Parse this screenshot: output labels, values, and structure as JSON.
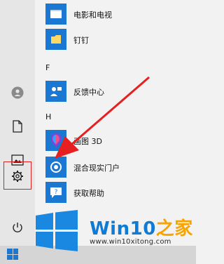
{
  "apps": [
    {
      "name": "电影和电视",
      "icon": "film-icon"
    },
    {
      "name": "钉钉",
      "icon": "dingtalk-icon"
    },
    {
      "name": "反馈中心",
      "icon": "feedback-hub-icon"
    },
    {
      "name": "画图 3D",
      "icon": "paint-3d-icon"
    },
    {
      "name": "混合现实门户",
      "icon": "mixed-reality-icon"
    },
    {
      "name": "获取帮助",
      "icon": "get-help-icon"
    }
  ],
  "sections": {
    "f": "F",
    "h": "H"
  },
  "rail": {
    "items": [
      {
        "name": "user-account-icon"
      },
      {
        "name": "documents-icon"
      },
      {
        "name": "pictures-icon"
      },
      {
        "name": "settings-icon"
      },
      {
        "name": "power-icon"
      }
    ]
  },
  "watermark": {
    "brand_win": "Win10",
    "brand_zh": "之家",
    "url": "www.win10xitong.com"
  },
  "colors": {
    "accent": "#0f7bd4",
    "tile": "#1a77d2",
    "highlight": "#e02020",
    "arrow": "#e62020"
  }
}
